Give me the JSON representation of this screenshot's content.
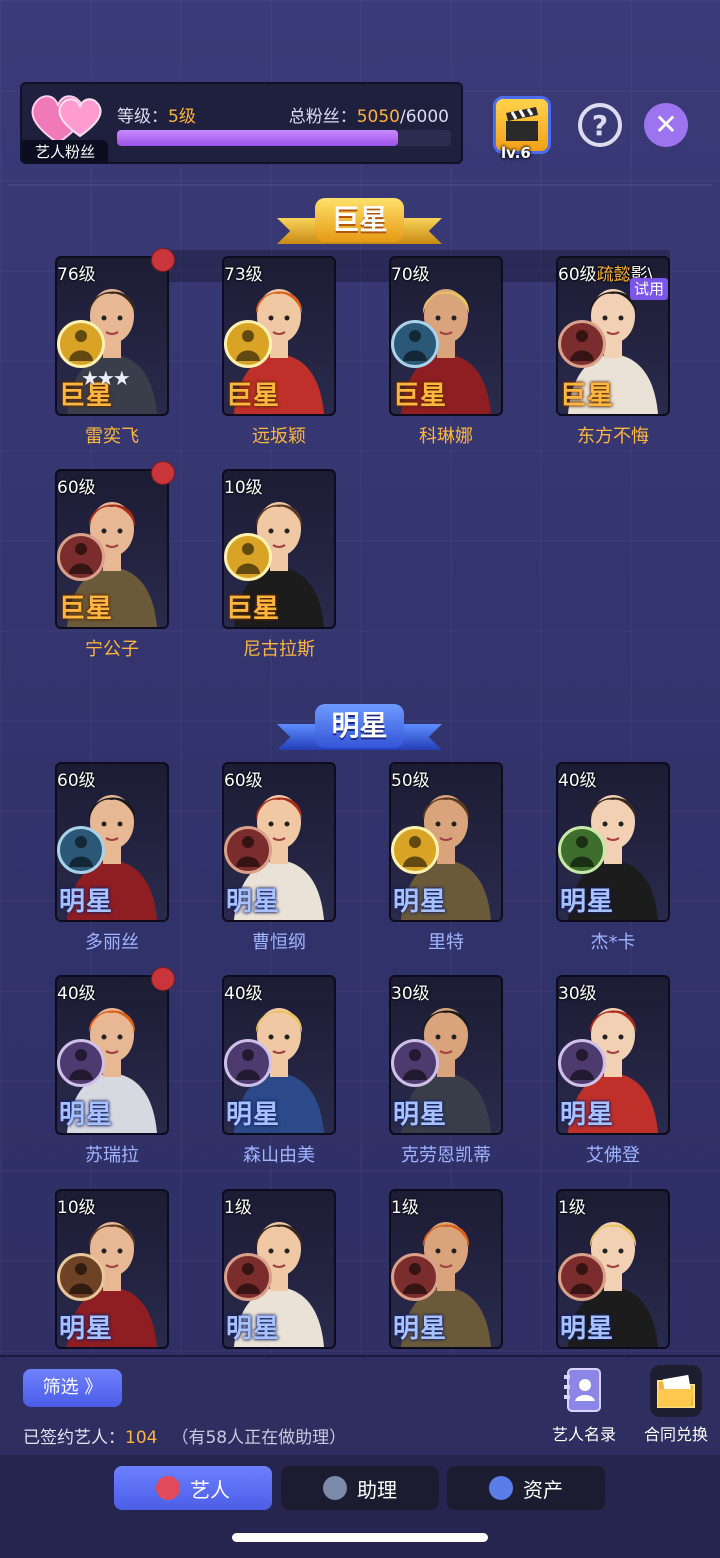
{
  "header": {
    "fans_tag": "艺人粉丝",
    "level_label": "等级：",
    "level_value": "5级",
    "fans_label": "总粉丝：",
    "fans_current": "5050",
    "fans_max": "/6000",
    "fans_progress_fraction": 0.84,
    "studio_level": "lv.6",
    "help_symbol": "?",
    "close_symbol": "✕"
  },
  "sections": {
    "superstar_title": "巨星",
    "star_title": "明星"
  },
  "superstars": [
    {
      "level": "76级",
      "rank": "巨星",
      "name": "雷奕飞",
      "badge": "soldier-icon",
      "stars": "★★★",
      "notify": true
    },
    {
      "level": "73级",
      "rank": "巨星",
      "name": "远坂颖",
      "badge": "soldier-icon"
    },
    {
      "level": "70级",
      "rank": "巨星",
      "name": "科琳娜",
      "badge": "ufo-icon"
    },
    {
      "level": "60级",
      "level_extra": "疏懿",
      "level_extra2": "影\\",
      "trial": "试用",
      "rank": "巨星",
      "name": "东方不悔",
      "badge": "silhouette-icon"
    },
    {
      "level": "60级",
      "rank": "巨星",
      "name": "宁公子",
      "badge": "silhouette-icon",
      "notify": true
    },
    {
      "level": "10级",
      "rank": "巨星",
      "name": "尼古拉斯",
      "badge": "soldier-icon"
    }
  ],
  "stars": [
    {
      "level": "60级",
      "rank": "明星",
      "name": "多丽丝",
      "badge": "ufo-icon"
    },
    {
      "level": "60级",
      "rank": "明星",
      "name": "曹恒纲",
      "badge": "silhouette-icon"
    },
    {
      "level": "50级",
      "rank": "明星",
      "name": "里特",
      "badge": "soldier-icon"
    },
    {
      "level": "40级",
      "rank": "明星",
      "name": "杰*卡",
      "badge": "statue-icon"
    },
    {
      "level": "40级",
      "rank": "明星",
      "name": "苏瑞拉",
      "badge": "dancer-icon",
      "notify": true
    },
    {
      "level": "40级",
      "rank": "明星",
      "name": "森山由美",
      "badge": "dancer-icon"
    },
    {
      "level": "30级",
      "rank": "明星",
      "name": "克劳恩凯蒂",
      "badge": "tennis-icon"
    },
    {
      "level": "30级",
      "rank": "明星",
      "name": "艾佛登",
      "badge": "tennis-icon"
    },
    {
      "level": "10级",
      "rank": "明星",
      "name": "",
      "badge": "couple-icon"
    },
    {
      "level": "1级",
      "rank": "明星",
      "name": "",
      "badge": "silhouette-icon"
    },
    {
      "level": "1级",
      "rank": "明星",
      "name": "",
      "badge": "silhouette-icon"
    },
    {
      "level": "1级",
      "rank": "明星",
      "name": "",
      "badge": "silhouette-icon"
    }
  ],
  "bottom": {
    "filter_label": "筛选 》",
    "signed_label": "已签约艺人：",
    "signed_count": "104",
    "assistant_note": "（有58人正在做助理）",
    "directory_label": "艺人名录",
    "exchange_label": "合同兑换"
  },
  "tabs": [
    {
      "label": "艺人",
      "icon": "lips-icon",
      "active": true
    },
    {
      "label": "助理",
      "icon": "assistant-icon",
      "active": false
    },
    {
      "label": "资产",
      "icon": "asset-icon",
      "active": false
    }
  ],
  "colors": {
    "background": "#34346e",
    "accent_orange": "#ffb33b",
    "progress_purple": "#a85cf0",
    "superstar_gold": "#ffb63e",
    "star_blue": "#9fb4ff",
    "tab_active": "#5b6cf2"
  }
}
